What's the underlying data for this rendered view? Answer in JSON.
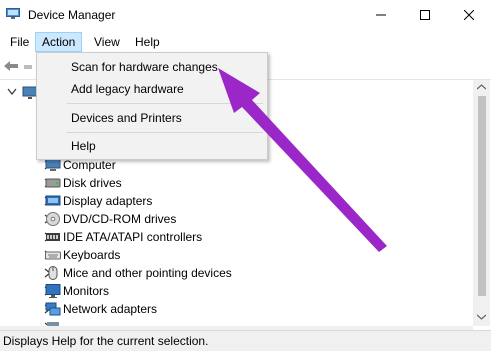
{
  "window": {
    "title": "Device Manager",
    "icon": "device-manager-icon",
    "controls": [
      "minimize-icon",
      "maximize-icon",
      "close-icon"
    ]
  },
  "menu": {
    "file": "File",
    "action": "Action",
    "view": "View",
    "help": "Help",
    "active": "Action"
  },
  "action_menu": {
    "scan": "Scan for hardware changes",
    "add_legacy": "Add legacy hardware",
    "devices_printers": "Devices and Printers",
    "help": "Help"
  },
  "toolbar": {
    "icons": [
      "back-arrow-icon"
    ]
  },
  "tree": {
    "items": [
      {
        "label": "Computer",
        "icon": "computer-icon"
      },
      {
        "label": "Disk drives",
        "icon": "disk-drive-icon"
      },
      {
        "label": "Display adapters",
        "icon": "display-adapter-icon"
      },
      {
        "label": "DVD/CD-ROM drives",
        "icon": "dvd-drive-icon"
      },
      {
        "label": "IDE ATA/ATAPI controllers",
        "icon": "ide-controller-icon"
      },
      {
        "label": "Keyboards",
        "icon": "keyboard-icon"
      },
      {
        "label": "Mice and other pointing devices",
        "icon": "mouse-icon"
      },
      {
        "label": "Monitors",
        "icon": "monitor-icon"
      },
      {
        "label": "Network adapters",
        "icon": "network-adapter-icon"
      }
    ]
  },
  "status": {
    "text": "Displays Help for the current selection."
  },
  "colors": {
    "menu_highlight": "#cce8ff",
    "menu_highlight_border": "#99d1ff",
    "dropdown_bg": "#f2f2f2",
    "annotation_arrow": "#9b27c9"
  }
}
